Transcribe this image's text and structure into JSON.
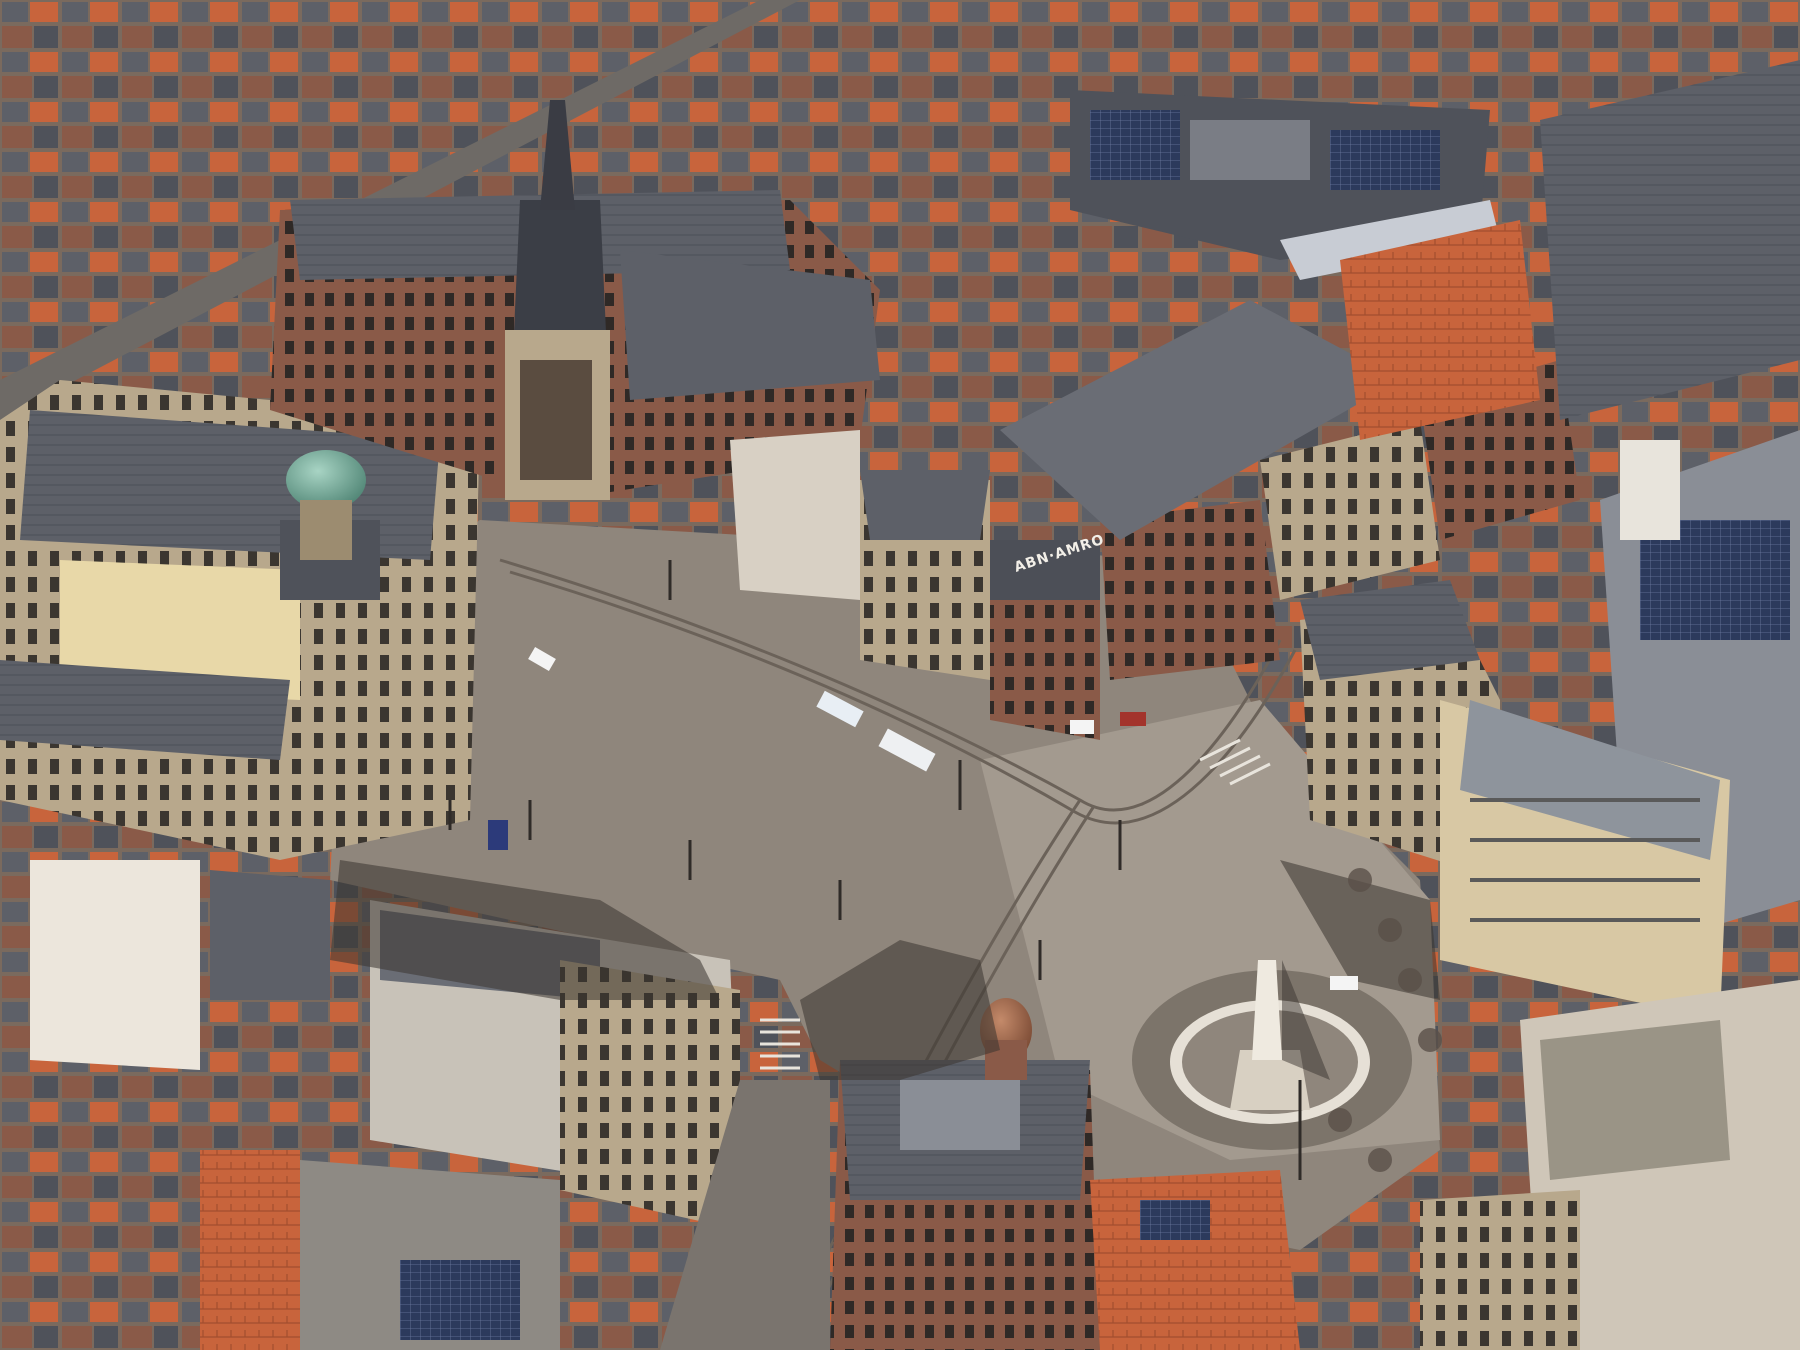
{
  "photo": {
    "signage": {
      "bank_sign": "ABN·AMRO"
    },
    "colors": {
      "square_paving": "#8f867c",
      "square_light": "#a39a8f",
      "slate_roof": "#5d6068",
      "sandstone": "#b8a88c",
      "brick": "#8a5a48",
      "orange_tile": "#c8643c",
      "dome_green": "#6fa394",
      "shadow": "#3a3430",
      "solar_panel": "#2c3a5c"
    }
  }
}
